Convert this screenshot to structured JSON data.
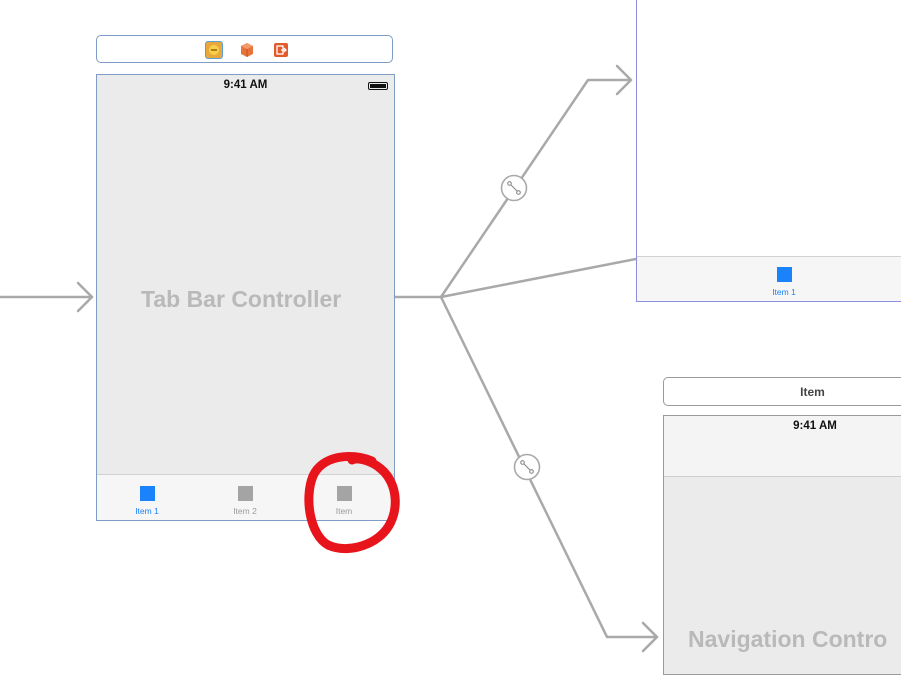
{
  "tab_bar_scene": {
    "status_time": "9:41 AM",
    "title": "Tab Bar Controller",
    "tabs": [
      {
        "label": "Item 1",
        "state": "selected",
        "color": "#1a82fb"
      },
      {
        "label": "Item 2",
        "state": "normal",
        "color": "#a4a4a4"
      },
      {
        "label": "Item",
        "state": "normal",
        "color": "#a4a4a4"
      }
    ],
    "dock_icons": [
      "view-controller-icon",
      "first-responder-icon",
      "exit-icon"
    ]
  },
  "top_right_scene": {
    "tab_label": "Item 1",
    "accent_color": "#1a82fb"
  },
  "bottom_right_scene": {
    "header_label": "Item",
    "status_time": "9:41 AM",
    "title": "Navigation Contro"
  },
  "annotation": {
    "type": "red-circle",
    "color": "#e8141c"
  },
  "colors": {
    "connection_line": "#a9a9a9",
    "scene_border": "#7e9cc6",
    "selected_scene_border": "#8c8fe0",
    "canvas": "#ffffff"
  }
}
